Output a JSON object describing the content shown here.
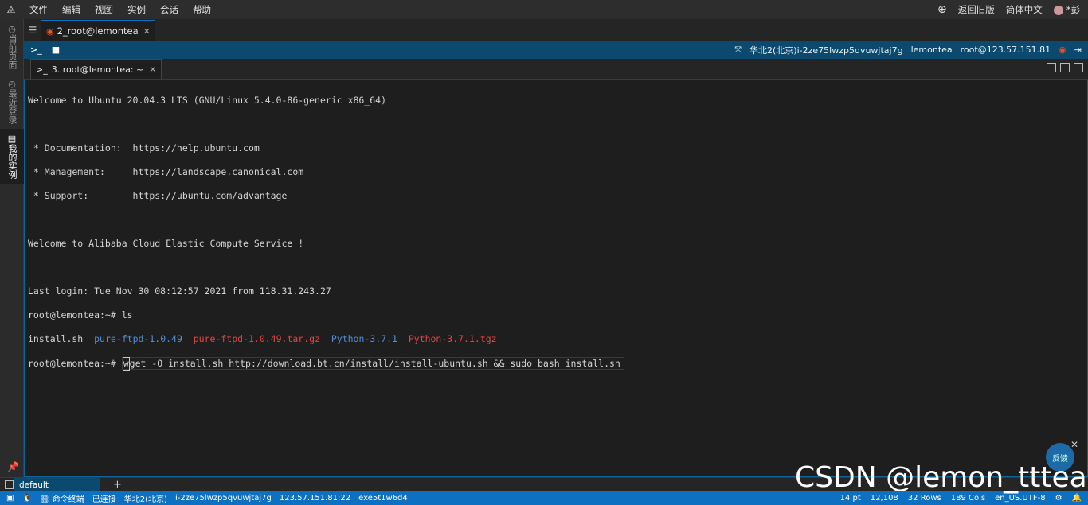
{
  "menubar": {
    "items": [
      "文件",
      "编辑",
      "视图",
      "实例",
      "会话",
      "帮助"
    ],
    "return_old": "返回旧版",
    "language": "简体中文",
    "user": "*彭"
  },
  "leftbar": {
    "tabs": [
      "当前页面",
      "最近登录",
      "我的实例"
    ]
  },
  "tab_main": {
    "label": "2_root@lemontea"
  },
  "session": {
    "region": "华北2(北京)",
    "instance": "i-2ze75lwzp5qvuwjtaj7g",
    "host": "lemontea",
    "login": "root@123.57.151.81"
  },
  "tab_term": {
    "label": "3. root@lemontea: ~"
  },
  "terminal": {
    "welcome": "Welcome to Ubuntu 20.04.3 LTS (GNU/Linux 5.4.0-86-generic x86_64)",
    "doc": " * Documentation:  https://help.ubuntu.com",
    "mgmt": " * Management:     https://landscape.canonical.com",
    "support": " * Support:        https://ubuntu.com/advantage",
    "alibaba": "Welcome to Alibaba Cloud Elastic Compute Service !",
    "last_login": "Last login: Tue Nov 30 08:12:57 2021 from 118.31.243.27",
    "prompt1": "root@lemontea:~# ",
    "cmd1": "ls",
    "ls_file1": "install.sh",
    "ls_dir1": "pure-ftpd-1.0.49",
    "ls_arch1": "pure-ftpd-1.0.49.tar.gz",
    "ls_dir2": "Python-3.7.1",
    "ls_arch2": "Python-3.7.1.tgz",
    "prompt2": "root@lemontea:~# ",
    "cmd2_first": "w",
    "cmd2_rest": "get -O install.sh http://download.bt.cn/install/install-ubuntu.sh && sudo bash install.sh"
  },
  "feedback": {
    "label": "反馈"
  },
  "bottom": {
    "default_tab": "default"
  },
  "status": {
    "mode": "命令终端",
    "connected": "已连接",
    "region": "华北2(北京)",
    "instance": "i-2ze75lwzp5qvuwjtaj7g",
    "address": "123.57.151.81:22",
    "session_id": "exe5t1w6d4",
    "font_size": "14 pt",
    "cursor": "12,108",
    "rows": "32 Rows",
    "cols": "189 Cols",
    "encoding": "en_US.UTF-8"
  },
  "watermark": "CSDN @lemon_tttea"
}
